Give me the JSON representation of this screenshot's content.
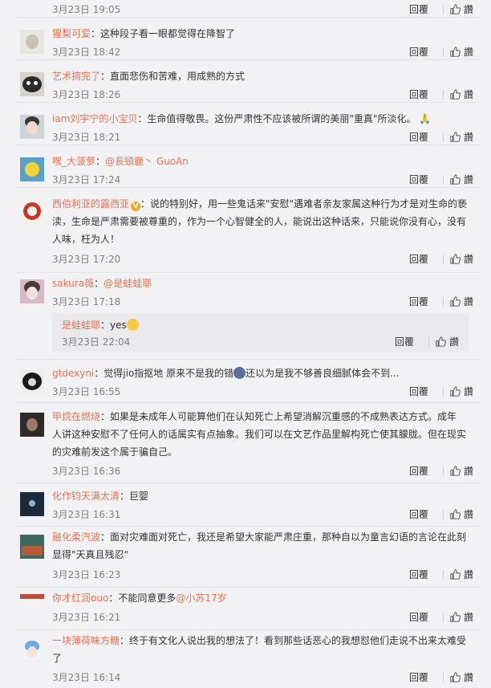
{
  "first_row": {
    "time": "3月23日 19:05",
    "reply": "回覆",
    "like": "讚"
  },
  "comments": [
    {
      "user": "猩梨可爱",
      "content": "这种段子看一眼都觉得在降智了",
      "time": "3月23日 18:42",
      "reply": "回覆",
      "like": "讚"
    },
    {
      "user": "艺术搞完了",
      "content": "直面悲伤和苦难，用成熟的方式",
      "time": "3月23日 18:26",
      "reply": "回覆",
      "like": "讚"
    },
    {
      "user": "iam刘宇宁的小宝贝",
      "content": "生命值得敬畏。这份严肃性不应该被所谓的美丽\"重真\"所淡化。",
      "emoji": "🙏",
      "time": "3月23日 18:21",
      "reply": "回覆",
      "like": "讚"
    },
    {
      "user": "嘿_大菠萝",
      "mention": "@長頸鹿丶 GuoAn",
      "time": "3月23日 17:24",
      "reply": "回覆",
      "like": "讚"
    },
    {
      "user": "西伯利亚的露西亚",
      "line1": "说的特别好，用一些鬼话来\"安慰\"遇难者亲友家属这种行为才是对生命的亵",
      "line2": "渎，生命是严肃需要被尊重的，作为一个心智健全的人，能说出这种话来，只能说你没有心，没有",
      "line3": "人味，枉为人！",
      "time": "3月23日 17:20",
      "reply": "回覆",
      "like": "讚"
    },
    {
      "user": "sakura薇",
      "mention": "@是蛙蛙耶",
      "time": "3月23日 17:18",
      "reply": "回覆",
      "like": "讚",
      "sub": {
        "user": "是蛙蛙耶",
        "content": "yes",
        "time": "3月23日 22:04",
        "reply": "回覆",
        "like": "讚"
      }
    },
    {
      "user": "gtdexyni",
      "content_a": "觉得jio指抠地 原来不是我的错",
      "content_b": "还以为是我不够善良细腻体会不到...",
      "time": "3月23日 16:55",
      "reply": "回覆",
      "like": "讚"
    },
    {
      "user": "甲烷在燃烧",
      "line1": "如果是未成年人可能算他们在认知死亡上希望消解沉重感的不成熟表达方式。成年",
      "line2": "人讲这种安慰不了任何人的话属实有点抽象。我们可以在文艺作品里解构死亡使其朦胧。但在现实",
      "line3": "的灾难前发这个属于骗自己。",
      "time": "3月23日 16:36",
      "reply": "回覆",
      "like": "讚"
    },
    {
      "user": "化作钧天满太清",
      "content": "巨婴",
      "time": "3月23日 16:31",
      "reply": "回覆",
      "like": "讚"
    },
    {
      "user": "融化柔汽波",
      "line1": "面对灾难面对死亡，我还是希望大家能严肃庄重，那种自以为童言幻语的言论在此刻",
      "line2": "显得\"天真且残忍\"",
      "time": "3月23日 16:23",
      "reply": "回覆",
      "like": "讚"
    },
    {
      "user": "你才红润ouo",
      "content": "不能同意更多",
      "mention": "@小苏17岁",
      "time": "3月23日 16:21",
      "reply": "回覆",
      "like": "讚"
    },
    {
      "user": "一块薄荷味方糖",
      "line1": "终于有文化人说出我的想法了！看到那些话恶心的我想怼他们走说不出来太难受",
      "line2": "了",
      "time": "3月23日 16:14",
      "reply": "回覆",
      "like": "讚"
    }
  ],
  "vbadge": "V",
  "colors": {
    "username": "#eb7350",
    "background": "#f2f2f5",
    "time": "#808080"
  },
  "icons": {
    "like": "thumb-up-icon"
  }
}
